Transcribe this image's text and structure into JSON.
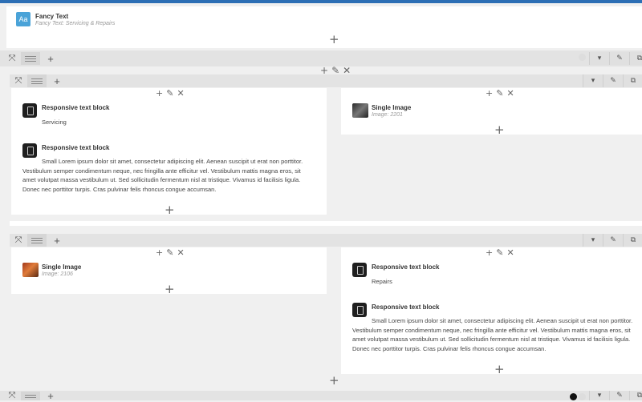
{
  "header_element": {
    "icon_text": "Aa",
    "title": "Fancy Text",
    "subtitle": "Fancy Text: Servicing & Repairs"
  },
  "controls": {
    "add_symbol": "+",
    "edit_symbol": "✎",
    "delete_symbol": "✕",
    "dropdown_symbol": "▾",
    "duplicate_symbol": "⧉",
    "expand_symbol": "⤧"
  },
  "section1": {
    "left": {
      "block1": {
        "title": "Responsive text block",
        "text": "Servicing"
      },
      "block2": {
        "title": "Responsive text block",
        "text": "Small Lorem ipsum dolor sit amet, consectetur adipiscing elit. Aenean suscipit ut erat non porttitor. Vestibulum semper condimentum neque, nec fringilla ante efficitur vel. Vestibulum mattis magna eros, sit amet volutpat massa vestibulum ut. Sed sollicitudin fermentum nisl at tristique. Vivamus id facilisis ligula. Donec nec porttitor turpis. Cras pulvinar felis rhoncus congue accumsan."
      }
    },
    "right": {
      "image": {
        "title": "Single Image",
        "subtitle": "Image: 2201"
      }
    }
  },
  "section2": {
    "left": {
      "image": {
        "title": "Single Image",
        "subtitle": "Image: 2106"
      }
    },
    "right": {
      "block1": {
        "title": "Responsive text block",
        "text": "Repairs"
      },
      "block2": {
        "title": "Responsive text block",
        "text": "Small Lorem ipsum dolor sit amet, consectetur adipiscing elit. Aenean suscipit ut erat non porttitor. Vestibulum semper condimentum neque, nec fringilla ante efficitur vel. Vestibulum mattis magna eros, sit amet volutpat massa vestibulum ut. Sed sollicitudin fermentum nisl at tristique. Vivamus id facilisis ligula. Donec nec porttitor turpis. Cras pulvinar felis rhoncus congue accumsan."
      }
    }
  }
}
